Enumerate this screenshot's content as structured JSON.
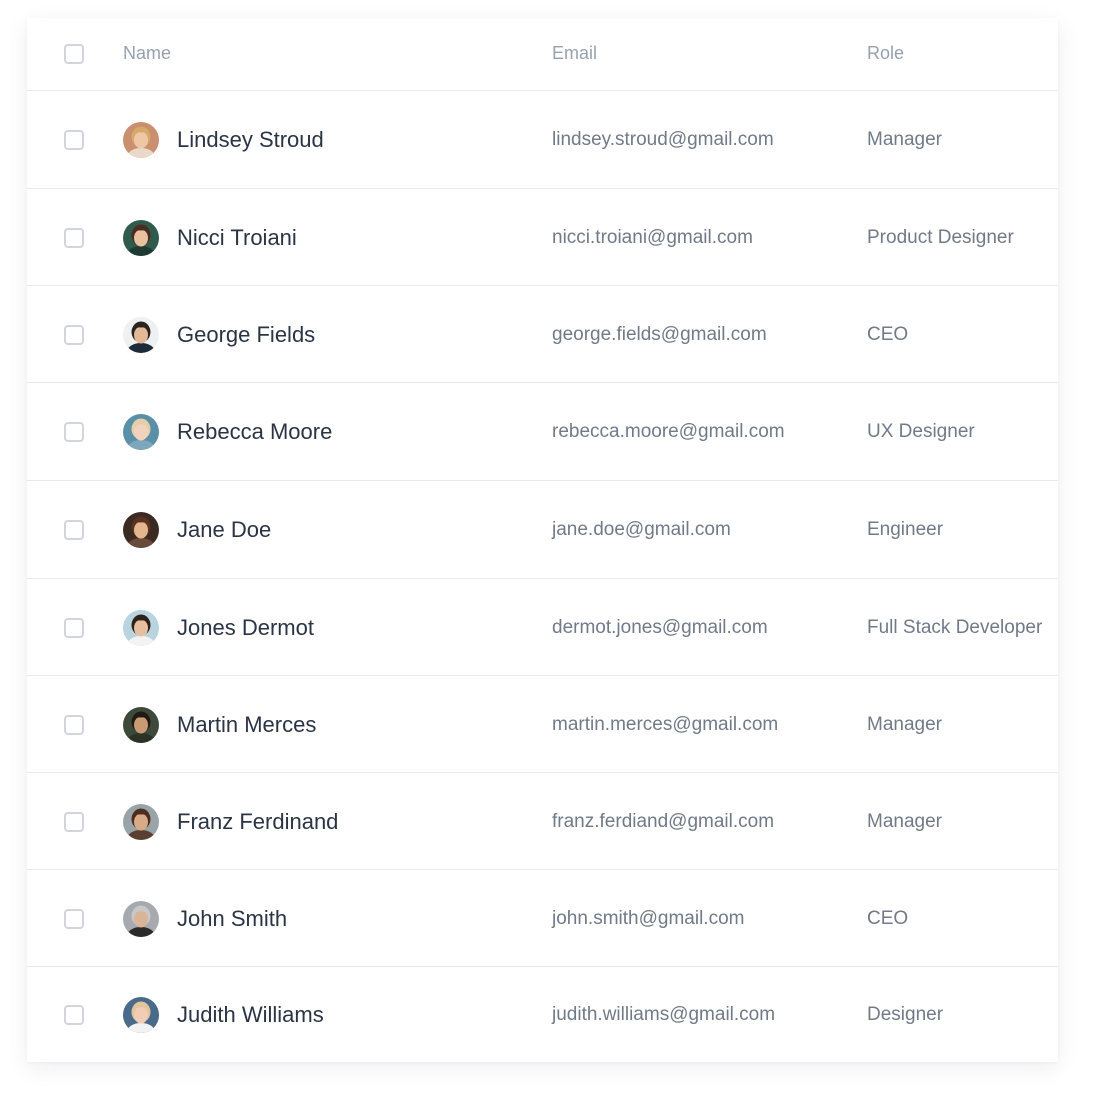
{
  "table": {
    "columns": {
      "name": "Name",
      "email": "Email",
      "role": "Role"
    },
    "rows": [
      {
        "name": "Lindsey Stroud",
        "email": "lindsey.stroud@gmail.com",
        "role": "Manager",
        "avatar": {
          "bg": "#c98f6e",
          "hair": "#d8a86a",
          "skin": "#f0c7a6",
          "shirt": "#e8d9c8"
        }
      },
      {
        "name": "Nicci Troiani",
        "email": "nicci.troiani@gmail.com",
        "role": "Product Designer",
        "avatar": {
          "bg": "#2f5a4c",
          "hair": "#4a2d20",
          "skin": "#e9c0a0",
          "shirt": "#1f3a33"
        }
      },
      {
        "name": "George Fields",
        "email": "george.fields@gmail.com",
        "role": "CEO",
        "avatar": {
          "bg": "#eef0f2",
          "hair": "#2a2420",
          "skin": "#e2b896",
          "shirt": "#1d2a3a"
        }
      },
      {
        "name": "Rebecca Moore",
        "email": "rebecca.moore@gmail.com",
        "role": "UX Designer",
        "avatar": {
          "bg": "#5a8fa8",
          "hair": "#e4cfa8",
          "skin": "#f1d2bc",
          "shirt": "#7fa7bb"
        }
      },
      {
        "name": "Jane Doe",
        "email": "jane.doe@gmail.com",
        "role": "Engineer",
        "avatar": {
          "bg": "#3a2a22",
          "hair": "#5a3320",
          "skin": "#e4b690",
          "shirt": "#6a4a3a"
        }
      },
      {
        "name": "Jones Dermot",
        "email": "dermot.jones@gmail.com",
        "role": "Full Stack Developer",
        "avatar": {
          "bg": "#b9d4de",
          "hair": "#2e2218",
          "skin": "#e7bfa0",
          "shirt": "#f3f3f3"
        }
      },
      {
        "name": "Martin Merces",
        "email": "martin.merces@gmail.com",
        "role": "Manager",
        "avatar": {
          "bg": "#3d4a3a",
          "hair": "#221a14",
          "skin": "#c99a74",
          "shirt": "#2b3326"
        }
      },
      {
        "name": "Franz Ferdinand",
        "email": "franz.ferdiand@gmail.com",
        "role": "Manager",
        "avatar": {
          "bg": "#9aa4a8",
          "hair": "#4a2e1e",
          "skin": "#d8ab88",
          "shirt": "#5a4030"
        }
      },
      {
        "name": "John Smith",
        "email": "john.smith@gmail.com",
        "role": "CEO",
        "avatar": {
          "bg": "#a6a9ad",
          "hair": "#c8c8c8",
          "skin": "#d9b497",
          "shirt": "#2a2a2a"
        }
      },
      {
        "name": "Judith Williams",
        "email": "judith.williams@gmail.com",
        "role": "Designer",
        "avatar": {
          "bg": "#4a6a8a",
          "hair": "#e0c49a",
          "skin": "#f0cdb4",
          "shirt": "#f2f2f2"
        }
      }
    ]
  }
}
